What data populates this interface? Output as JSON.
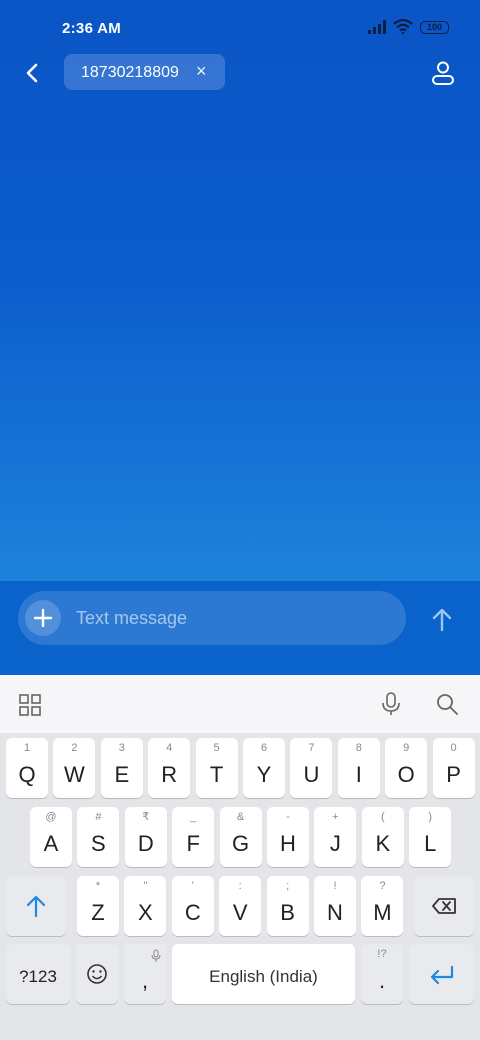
{
  "status_bar": {
    "time": "2:36 AM",
    "battery": "100",
    "icons": [
      "signal-icon",
      "wifi-icon",
      "battery-icon"
    ]
  },
  "header": {
    "back_icon": "back-arrow-icon",
    "recipient": "18730218809",
    "recipient_remove": "×",
    "contact_icon": "person-icon"
  },
  "compose": {
    "add_icon": "plus-icon",
    "placeholder": "Text message",
    "send_icon": "send-arrow-icon"
  },
  "keyboard_toolbar": {
    "icons": [
      "apps-grid-icon",
      "microphone-icon",
      "search-icon"
    ]
  },
  "keyboard": {
    "row1": [
      {
        "hint": "1",
        "key": "Q"
      },
      {
        "hint": "2",
        "key": "W"
      },
      {
        "hint": "3",
        "key": "E"
      },
      {
        "hint": "4",
        "key": "R"
      },
      {
        "hint": "5",
        "key": "T"
      },
      {
        "hint": "6",
        "key": "Y"
      },
      {
        "hint": "7",
        "key": "U"
      },
      {
        "hint": "8",
        "key": "I"
      },
      {
        "hint": "9",
        "key": "O"
      },
      {
        "hint": "0",
        "key": "P"
      }
    ],
    "row2": [
      {
        "hint": "@",
        "key": "A"
      },
      {
        "hint": "#",
        "key": "S"
      },
      {
        "hint": "₹",
        "key": "D"
      },
      {
        "hint": "_",
        "key": "F"
      },
      {
        "hint": "&",
        "key": "G"
      },
      {
        "hint": "-",
        "key": "H"
      },
      {
        "hint": "+",
        "key": "J"
      },
      {
        "hint": "(",
        "key": "K"
      },
      {
        "hint": ")",
        "key": "L"
      }
    ],
    "row3": [
      {
        "hint": "*",
        "key": "Z"
      },
      {
        "hint": "\"",
        "key": "X"
      },
      {
        "hint": "'",
        "key": "C"
      },
      {
        "hint": ":",
        "key": "V"
      },
      {
        "hint": ";",
        "key": "B"
      },
      {
        "hint": "!",
        "key": "N"
      },
      {
        "hint": "?",
        "key": "M"
      }
    ],
    "symbols_label": "?123",
    "comma": ",",
    "space_label": "English (India)",
    "period_hint": "!?",
    "period": ".",
    "accent_color": "#1e88e5"
  }
}
